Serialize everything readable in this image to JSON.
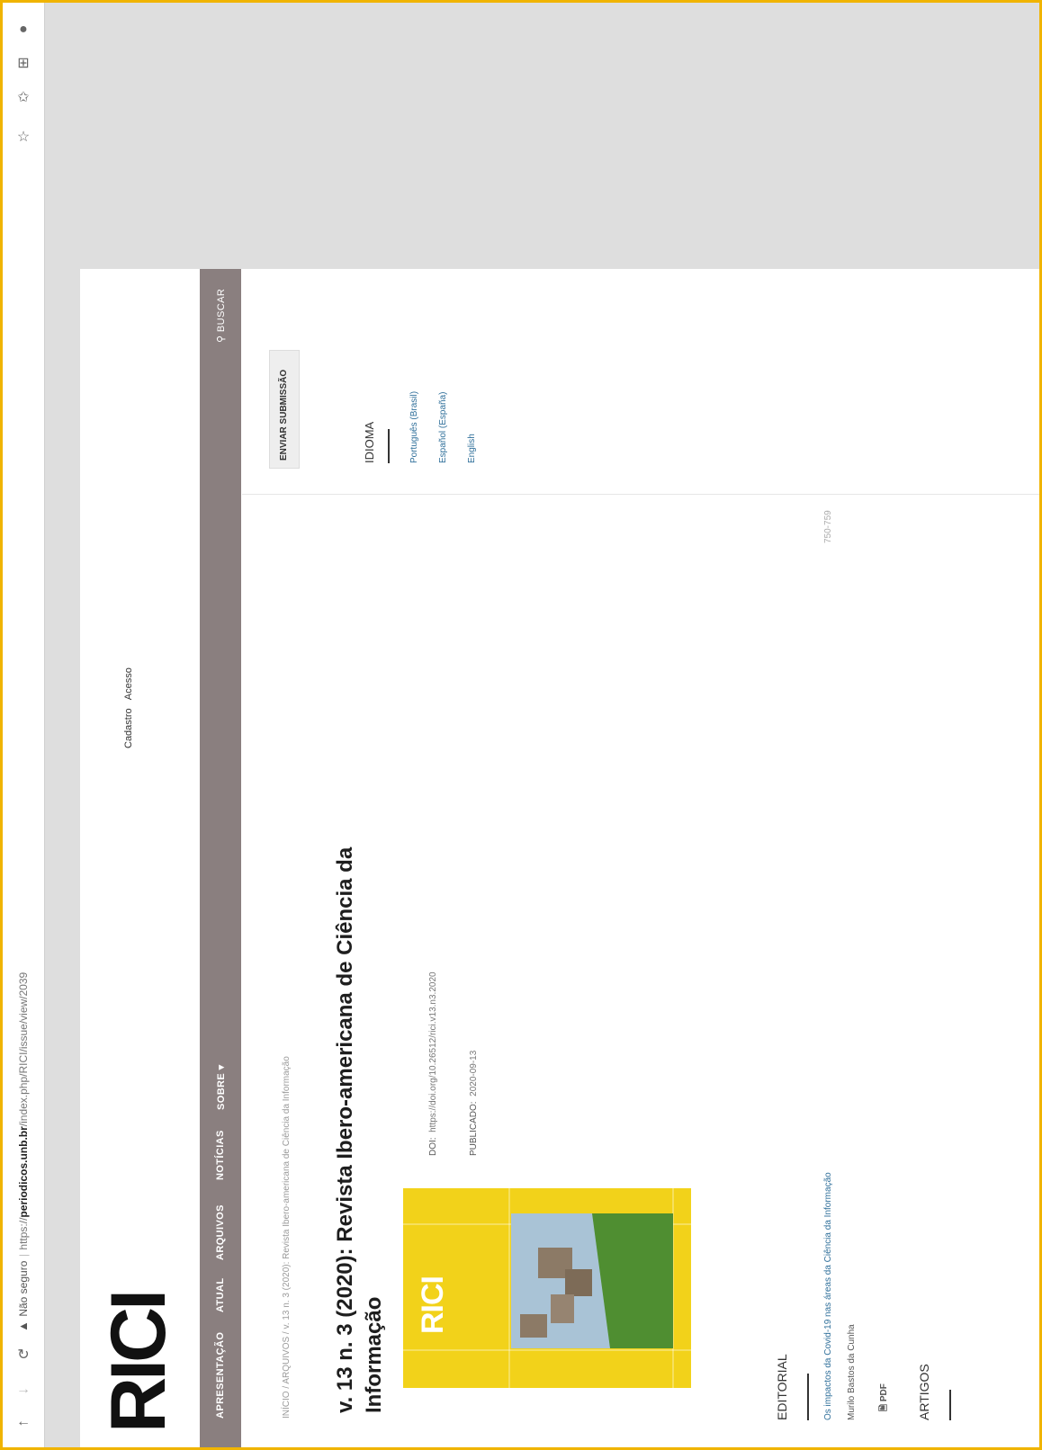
{
  "browser": {
    "not_secure_label": "Não seguro",
    "url_prefix": "https://",
    "url_host": "periodicos.unb.br",
    "url_path": "/index.php/RICI/issue/view/2039"
  },
  "site": {
    "logo_text": "RICI",
    "user_links": [
      "Cadastro",
      "Acesso"
    ],
    "nav": [
      "APRESENTAÇÃO",
      "ATUAL",
      "ARQUIVOS",
      "NOTÍCIAS",
      "SOBRE ▾"
    ],
    "search_label": "BUSCAR"
  },
  "breadcrumb": {
    "home": "INÍCIO",
    "sep1": "/",
    "archives": "ARQUIVOS",
    "sep2": "/",
    "current": "v. 13 n. 3 (2020): Revista Ibero-americana de Ciência da Informação"
  },
  "issue": {
    "title_line1": "v. 13 n. 3 (2020): Revista Ibero-americana de Ciência da",
    "title_line2": "Informação",
    "doi_label": "DOI:",
    "doi_value": "https://doi.org/10.26512/rici.v13.n3.2020",
    "published_label": "PUBLICADO:",
    "published_value": "2020-09-13",
    "cover_logo": "RICI"
  },
  "sections": {
    "editorial_heading": "EDITORIAL",
    "editorial_item": {
      "title": "Os impactos da Covid-19 nas áreas da Ciência da Informação",
      "pages": "750-759",
      "author": "Murilo Bastos da Cunha",
      "galley": "PDF"
    },
    "articles_heading": "ARTIGOS"
  },
  "sidebar": {
    "submit_button": "ENVIAR SUBMISSÃO",
    "language_heading": "IDIOMA",
    "languages": [
      "Português (Brasil)",
      "Español (España)",
      "English"
    ]
  },
  "colors": {
    "frame": "#f0b400",
    "navbar": "#8a7f7f",
    "link": "#2f6f9a",
    "cover": "#f2d21a"
  }
}
